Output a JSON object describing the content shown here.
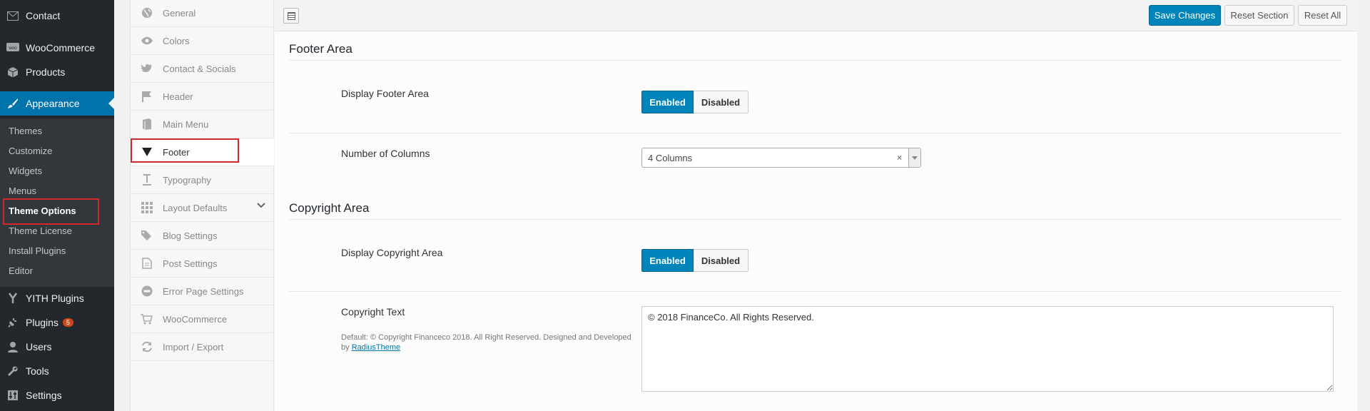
{
  "wp_menu": {
    "contact": "Contact",
    "woocommerce": "WooCommerce",
    "products": "Products",
    "appearance": "Appearance",
    "submenu": [
      "Themes",
      "Customize",
      "Widgets",
      "Menus",
      "Theme Options",
      "Theme License",
      "Install Plugins",
      "Editor"
    ],
    "yith": "YITH Plugins",
    "plugins": "Plugins",
    "plugins_badge": "5",
    "users": "Users",
    "tools": "Tools",
    "settings": "Settings"
  },
  "options_nav": [
    "General",
    "Colors",
    "Contact & Socials",
    "Header",
    "Main Menu",
    "Footer",
    "Typography",
    "Layout Defaults",
    "Blog Settings",
    "Post Settings",
    "Error Page Settings",
    "WooCommerce",
    "Import / Export"
  ],
  "toolbar": {
    "save": "Save Changes",
    "reset_section": "Reset Section",
    "reset_all": "Reset All"
  },
  "footer_area": {
    "title": "Footer Area",
    "display_label": "Display Footer Area",
    "enabled": "Enabled",
    "disabled": "Disabled",
    "columns_label": "Number of Columns",
    "columns_value": "4 Columns",
    "clear_glyph": "×"
  },
  "copyright_area": {
    "title": "Copyright Area",
    "display_label": "Display Copyright Area",
    "enabled": "Enabled",
    "disabled": "Disabled",
    "text_label": "Copyright Text",
    "desc_prefix": "Default: © Copyright Financeco 2018. All Right Reserved. Designed and Developed by ",
    "desc_link": "RadiusTheme",
    "text_value": "© 2018 FinanceCo. All Rights Reserved."
  },
  "colors": {
    "wp_sidebar": "#23282d",
    "accent": "#0085ba",
    "highlight_border": "#d0282c"
  }
}
